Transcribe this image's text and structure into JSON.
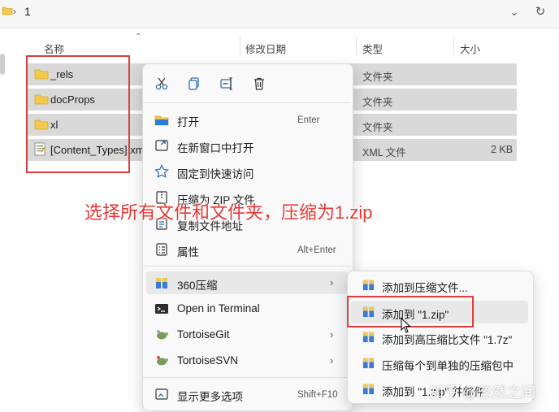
{
  "breadcrumb": {
    "separator": "›",
    "current": "1"
  },
  "columns": {
    "name": "名称",
    "date": "修改日期",
    "type": "类型",
    "size": "大小"
  },
  "files": [
    {
      "name": "_rels",
      "type": "文件夹",
      "size": "",
      "icon": "folder-icon"
    },
    {
      "name": "docProps",
      "type": "文件夹",
      "size": "",
      "icon": "folder-icon"
    },
    {
      "name": "xl",
      "type": "文件夹",
      "size": "",
      "icon": "folder-icon"
    },
    {
      "name": "[Content_Types].xm",
      "type": "XML 文件",
      "size": "2 KB",
      "icon": "xml-file-icon"
    }
  ],
  "context_menu": {
    "toolbar_icons": [
      "cut-icon",
      "copy-icon",
      "rename-icon",
      "delete-icon"
    ],
    "items": [
      {
        "label": "打开",
        "shortcut": "Enter"
      },
      {
        "label": "在新窗口中打开",
        "shortcut": ""
      },
      {
        "label": "固定到快速访问",
        "shortcut": ""
      },
      {
        "label": "压缩为 ZIP 文件",
        "shortcut": ""
      },
      {
        "label": "复制文件地址",
        "shortcut": ""
      },
      {
        "label": "属性",
        "shortcut": "Alt+Enter"
      },
      {
        "label": "360压缩",
        "shortcut": ""
      },
      {
        "label": "Open in Terminal",
        "shortcut": ""
      },
      {
        "label": "TortoiseGit",
        "shortcut": ""
      },
      {
        "label": "TortoiseSVN",
        "shortcut": ""
      },
      {
        "label": "显示更多选项",
        "shortcut": "Shift+F10"
      }
    ]
  },
  "submenu": {
    "items": [
      "添加到压缩文件...",
      "添加到 \"1.zip\"",
      "添加到高压缩比文件 \"1.7z\"",
      "压缩每个到单独的压缩包中",
      "添加到 \"1.zip\" 并邮件"
    ]
  },
  "annotation": "选择所有文件和文件夹，压缩为1.zip",
  "watermark": "知乎 @忽然之间",
  "colors": {
    "annotation_red": "#e53935",
    "selected_row": "#d9d9d9",
    "folder_yellow": "#f2c94c"
  }
}
